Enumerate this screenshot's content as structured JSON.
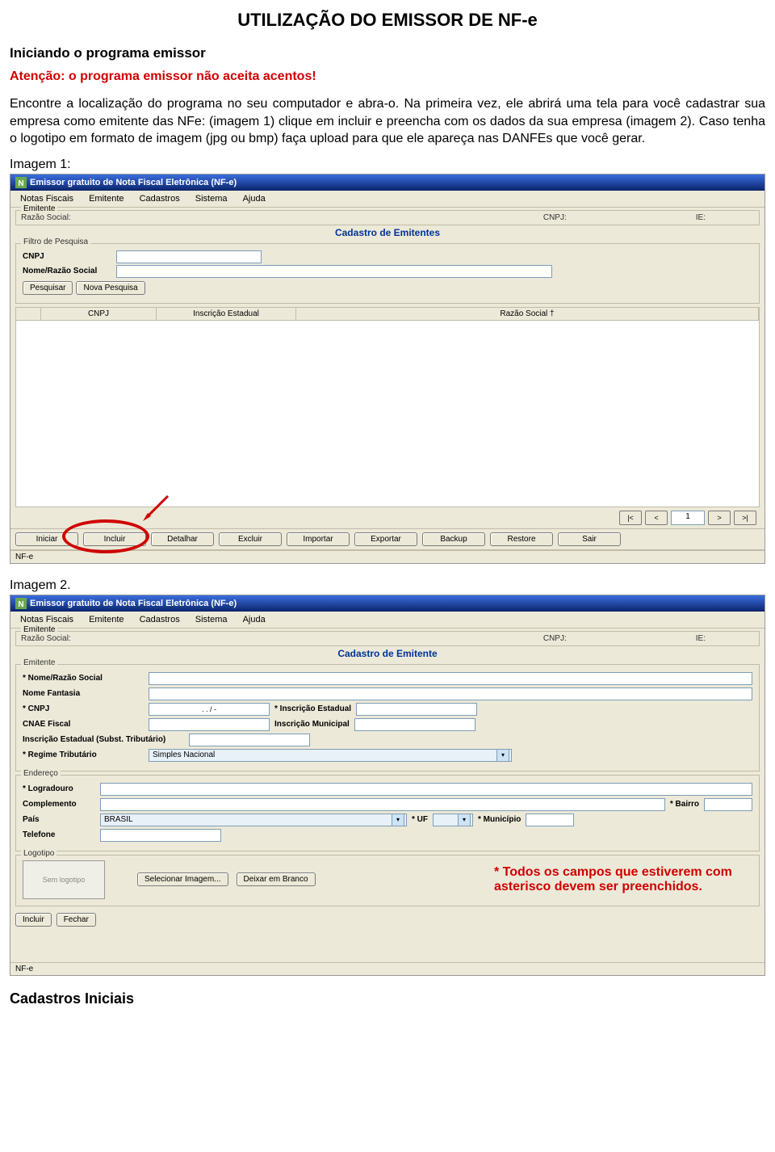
{
  "doc": {
    "title": "UTILIZAÇÃO DO EMISSOR DE NF-e",
    "intro_heading": "Iniciando o programa emissor",
    "warning": "Atenção: o programa emissor não aceita acentos!",
    "paragraph": "Encontre a localização do programa no seu computador e abra-o. Na primeira vez, ele abrirá uma tela para você cadastrar sua empresa como emitente das NFe: (imagem 1) clique em incluir e preencha com os dados da sua empresa (imagem 2). Caso tenha o logotipo em formato de imagem (jpg ou bmp) faça upload para que ele apareça nas DANFEs que você gerar.",
    "img1_label": "Imagem 1:",
    "img2_label": "Imagem 2.",
    "note_red": "* Todos os campos que estiverem com asterisco devem ser preenchidos.",
    "footer_heading": "Cadastros Iniciais"
  },
  "app": {
    "window_title": "Emissor gratuito de Nota Fiscal Eletrônica (NF-e)",
    "menus": [
      "Notas Fiscais",
      "Emitente",
      "Cadastros",
      "Sistema",
      "Ajuda"
    ],
    "emitente_bar": {
      "razao": "Razão Social:",
      "cnpj": "CNPJ:",
      "ie": "IE:"
    },
    "status": "NF-e"
  },
  "img1": {
    "section_title": "Cadastro de Emitentes",
    "filter_legend": "Filtro de Pesquisa",
    "lbl_cnpj": "CNPJ",
    "lbl_nome": "Nome/Razão Social",
    "btn_pesquisar": "Pesquisar",
    "btn_nova": "Nova Pesquisa",
    "cols": {
      "cnpj": "CNPJ",
      "ie": "Inscrição Estadual",
      "razao": "Razão Social †"
    },
    "pager": {
      "first": "|<",
      "prev": "<",
      "page": "1",
      "next": ">",
      "last": ">|"
    },
    "buttons": [
      "Iniciar",
      "Incluir",
      "Detalhar",
      "Excluir",
      "Importar",
      "Exportar",
      "Backup",
      "Restore",
      "Sair"
    ]
  },
  "img2": {
    "section_title": "Cadastro de Emitente",
    "legend_emitente": "Emitente",
    "lbl_nome_razao": "* Nome/Razão Social",
    "lbl_fantasia": "Nome Fantasia",
    "lbl_cnpj": "* CNPJ",
    "cnpj_mask": ". . / -",
    "lbl_ie": "* Inscrição Estadual",
    "lbl_cnae": "CNAE Fiscal",
    "lbl_im": "Inscrição Municipal",
    "lbl_ie_st": "Inscrição Estadual (Subst. Tributário)",
    "lbl_regime": "* Regime Tributário",
    "regime_value": "Simples Nacional",
    "legend_endereco": "Endereço",
    "lbl_logradouro": "* Logradouro",
    "lbl_complemento": "Complemento",
    "lbl_bairro": "* Bairro",
    "lbl_pais": "País",
    "pais_value": "BRASIL",
    "lbl_uf": "* UF",
    "lbl_municipio": "* Município",
    "lbl_telefone": "Telefone",
    "legend_logotipo": "Logotipo",
    "logo_placeholder": "Sem logotipo",
    "btn_sel_img": "Selecionar Imagem...",
    "btn_branco": "Deixar em Branco",
    "btn_incluir": "Incluir",
    "btn_fechar": "Fechar"
  }
}
